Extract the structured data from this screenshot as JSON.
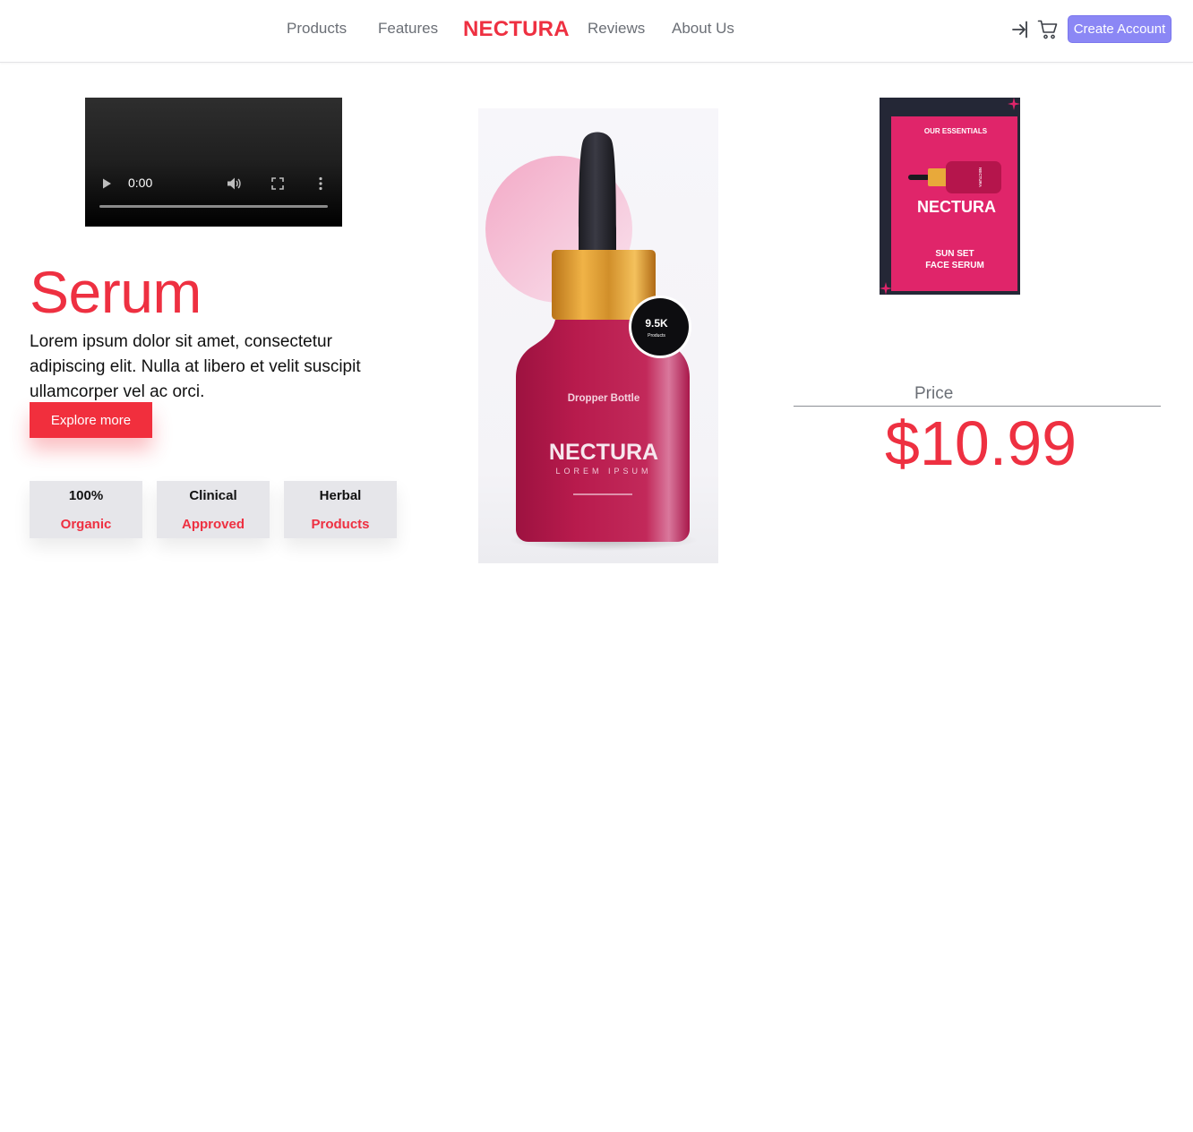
{
  "nav": {
    "links": [
      "Products",
      "Features",
      "Reviews",
      "About Us"
    ],
    "brand": "NECTURA",
    "icons": [
      "sign-in-icon",
      "cart-icon"
    ],
    "create_account_label": "Create Account"
  },
  "video": {
    "time": "0:00",
    "icons": [
      "play-icon",
      "volume-icon",
      "fullscreen-icon",
      "more-options-icon"
    ]
  },
  "hero": {
    "title": "Serum",
    "description": "Lorem ipsum dolor sit amet, consectetur adipiscing elit. Nulla at libero et velit suscipit ullamcorper vel ac orci.",
    "explore_label": "Explore more"
  },
  "features": [
    {
      "top": "100%",
      "bottom": "Organic"
    },
    {
      "top": "Clinical",
      "bottom": "Approved"
    },
    {
      "top": "Herbal",
      "bottom": "Products"
    }
  ],
  "product_image": {
    "badge_value": "9.5K",
    "badge_caption": "Products",
    "bottle_label": "Dropper Bottle",
    "brand": "NECTURA",
    "tagline": "LOREM IPSUM"
  },
  "promo": {
    "heading": "OUR ESSENTIALS",
    "brand": "NECTURA",
    "subtitle_line1": "SUN SET",
    "subtitle_line2": "FACE SERUM",
    "bottle_side_text": "NECTURA"
  },
  "price": {
    "label": "Price",
    "value": "$10.99"
  },
  "colors": {
    "accent": "#ee3041",
    "button_primary": "#8b87f5",
    "nav_text": "#6b6f76",
    "card_bg": "#e6e6ea",
    "bottle": "#b3174a",
    "promo_bg": "#e0256a"
  }
}
